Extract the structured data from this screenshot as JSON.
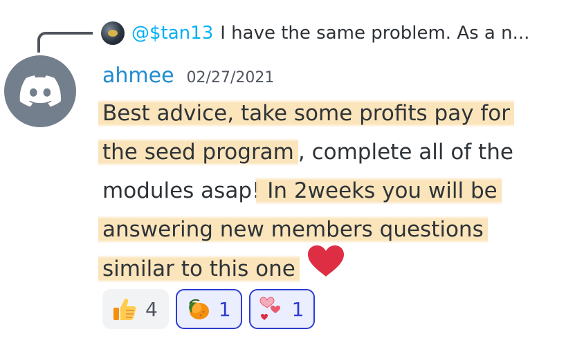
{
  "reply": {
    "mention": "@$tan13",
    "preview": "I have the same problem. As a n..."
  },
  "message": {
    "username": "ahmee",
    "timestamp": "02/27/2021",
    "lines": [
      "Best advice, take some profits pay for",
      "the seed program",
      ", complete all of the",
      "modules asap!",
      " In 2weeks you will be",
      "answering new members questions",
      "similar to this one"
    ]
  },
  "reactions": [
    {
      "icon": "thumbs-up-icon",
      "count": "4",
      "active": false
    },
    {
      "icon": "mango-icon",
      "count": "1",
      "active": true
    },
    {
      "icon": "two-hearts-icon",
      "count": "1",
      "active": true
    }
  ],
  "colors": {
    "mention": "#00aff4",
    "username": "#1f8ccf",
    "highlight": "#fae0af",
    "reaction_active_border": "#2b3bd1",
    "avatar_bg": "#747f8d"
  }
}
